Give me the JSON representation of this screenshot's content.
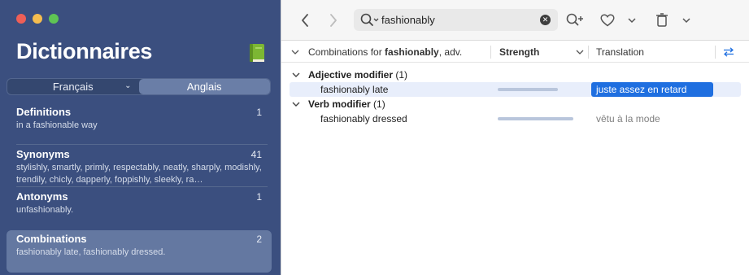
{
  "sidebar": {
    "title": "Dictionnaires",
    "lang_tabs": [
      "Français",
      "Anglais"
    ],
    "sections": [
      {
        "title": "Definitions",
        "count": "1",
        "desc": "in a fashionable way"
      },
      {
        "title": "Synonyms",
        "count": "41",
        "desc": "stylishly, smartly, primly, respectably, neatly, sharply, modishly, trendily, chicly, dapperly, foppishly, sleekly, ra…"
      },
      {
        "title": "Antonyms",
        "count": "1",
        "desc": "unfashionably."
      },
      {
        "title": "Combinations",
        "count": "2",
        "desc": "fashionably late, fashionably dressed."
      }
    ]
  },
  "toolbar": {
    "search_value": "fashionably"
  },
  "table": {
    "header_prefix": "Combinations for ",
    "header_word": "fashionably",
    "header_suffix": ", adv.",
    "col_strength": "Strength",
    "col_translation": "Translation",
    "groups": [
      {
        "name": "Adjective modifier",
        "count": "(1)",
        "rows": [
          {
            "phrase": "fashionably late",
            "strength": 0.8,
            "translation": "juste assez en retard"
          }
        ]
      },
      {
        "name": "Verb modifier",
        "count": "(1)",
        "rows": [
          {
            "phrase": "fashionably dressed",
            "strength": 1.0,
            "translation": "vêtu à la mode"
          }
        ]
      }
    ]
  },
  "colors": {
    "sidebar_bg": "#3b4f7f",
    "selection": "#1f6fe0"
  }
}
